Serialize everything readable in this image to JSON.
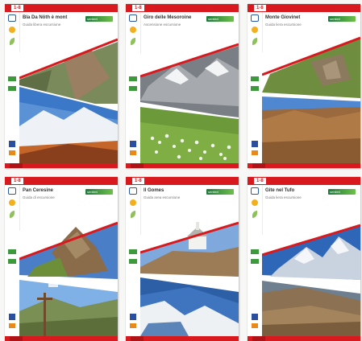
{
  "guides": [
    {
      "number": "1-8",
      "title": "Bla Da Nöth è mont",
      "subtitle": "Guida libera escursione"
    },
    {
      "number": "1-8",
      "title": "Giro delle Mesoroine",
      "subtitle": "Ascensione escursione"
    },
    {
      "number": "1-8",
      "title": "Monte Giovinet",
      "subtitle": "Guida liera escursione"
    },
    {
      "number": "1-8",
      "title": "Pan Ceresine",
      "subtitle": "Guida di escursione"
    },
    {
      "number": "1-8",
      "title": "Il Gomes",
      "subtitle": "Guida area escursione"
    },
    {
      "number": "1-8",
      "title": "Gite nel Tufo",
      "subtitle": "Guida liera escursione"
    }
  ],
  "brand_label": "sentieri",
  "colors": {
    "accent": "#d8191e",
    "brand_green": "#3c9a3c"
  }
}
